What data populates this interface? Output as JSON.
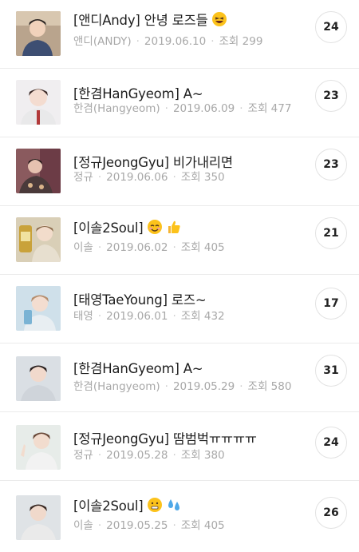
{
  "posts": [
    {
      "title": "[앤디Andy] 안녕 로즈들",
      "emoji": [
        "laughing-face"
      ],
      "author": "앤디(ANDY)",
      "date": "2019.06.10",
      "views": "조회 299",
      "comments": "24"
    },
    {
      "title": "[한겸HanGyeom] A~",
      "emoji": [],
      "author": "한겸(Hangyeom)",
      "date": "2019.06.09",
      "views": "조회 477",
      "comments": "23"
    },
    {
      "title": "[정규JeongGyu] 비가내리면",
      "emoji": [],
      "author": "정규",
      "date": "2019.06.06",
      "views": "조회 350",
      "comments": "23"
    },
    {
      "title": "[이솔2Soul]",
      "emoji": [
        "smiling-face",
        "thumbs-up"
      ],
      "author": "이솔",
      "date": "2019.06.02",
      "views": "조회 405",
      "comments": "21"
    },
    {
      "title": "[태영TaeYoung] 로즈~",
      "emoji": [],
      "author": "태영",
      "date": "2019.06.01",
      "views": "조회 432",
      "comments": "17"
    },
    {
      "title": "[한겸HanGyeom] A~",
      "emoji": [],
      "author": "한겸(Hangyeom)",
      "date": "2019.05.29",
      "views": "조회 580",
      "comments": "31"
    },
    {
      "title": "[정규JeongGyu] 땀범벅ㅠㅠㅠㅠ",
      "emoji": [],
      "author": "정규",
      "date": "2019.05.28",
      "views": "조회 380",
      "comments": "24"
    },
    {
      "title": "[이솔2Soul]",
      "emoji": [
        "grinning-face",
        "sweat-droplets"
      ],
      "author": "이솔",
      "date": "2019.05.25",
      "views": "조회 405",
      "comments": "26"
    }
  ],
  "colors": {
    "thumb_bg": [
      "#b9a48d",
      "#f0eef0",
      "#8a5a5e",
      "#d9cfb7",
      "#cfe0ea",
      "#dadfe4",
      "#e7ece9",
      "#dfe3e6"
    ],
    "thumb_shirt": [
      "#3d4e72",
      "#e9e9ea",
      "#4a3a3a",
      "#e7dfcf",
      "#e8eef2",
      "#cfd4da",
      "#f2f2f2",
      "#eaeaea"
    ]
  }
}
